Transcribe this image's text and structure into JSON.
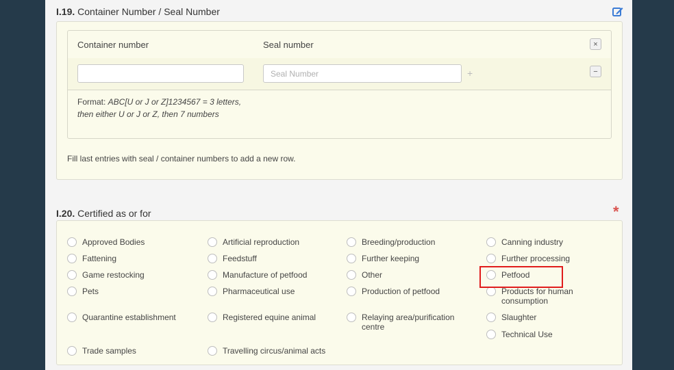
{
  "section_i19": {
    "number": "I.19.",
    "title": "Container Number / Seal Number",
    "col_container": "Container number",
    "col_seal": "Seal number",
    "container_value": "",
    "seal_placeholder": "Seal Number",
    "plus": "+",
    "remove_all_symbol": "×",
    "remove_row_symbol": "−",
    "format_label": "Format: ",
    "format_pattern": "ABC[U or J or Z]1234567 = 3 letters, then either U or J or Z, then 7 numbers",
    "hint": "Fill last entries with seal / container numbers to add a new row."
  },
  "section_i20": {
    "number": "I.20.",
    "title": "Certified as or for",
    "required_mark": "*",
    "options": [
      "Approved Bodies",
      "Artificial reproduction",
      "Breeding/production",
      "Canning industry",
      "Fattening",
      "Feedstuff",
      "Further keeping",
      "Further processing",
      "Game restocking",
      "Manufacture of petfood",
      "Other",
      "Petfood",
      "Pets",
      "Pharmaceutical use",
      "Production of petfood",
      "Products for human consumption",
      "Quarantine establishment",
      "Registered equine animal",
      "Relaying area/purification centre",
      "Slaughter",
      "Technical Use",
      "Trade samples",
      "Travelling circus/animal acts"
    ]
  },
  "colors": {
    "sidebar": "#253a4a",
    "page": "#f4f4f4",
    "panel": "#fbfbeb",
    "required": "#d9534f",
    "highlight": "#e01b1b",
    "edit_icon": "#3a7bd5"
  }
}
